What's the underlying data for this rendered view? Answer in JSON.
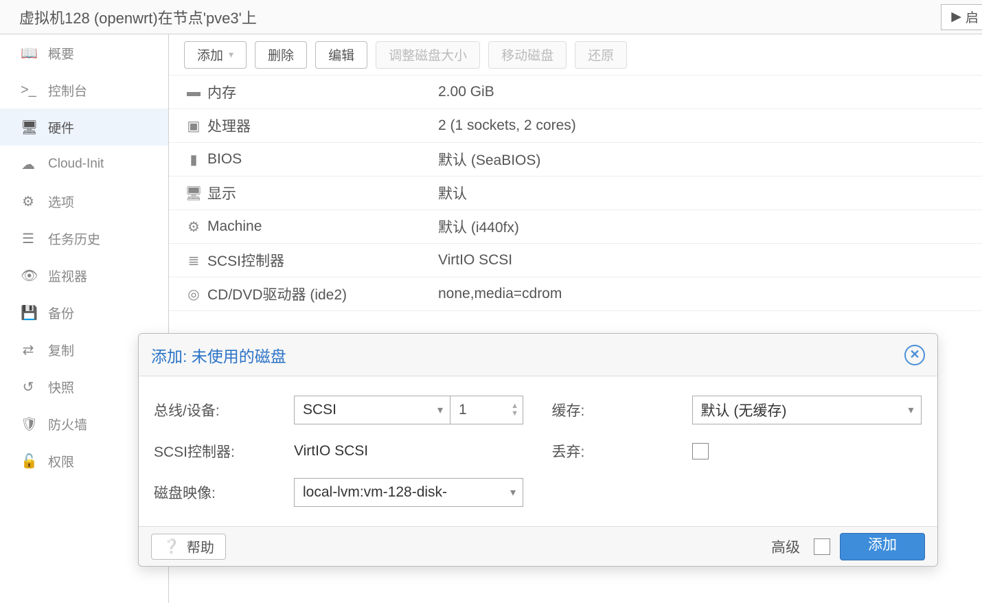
{
  "header": {
    "title": "虚拟机128 (openwrt)在节点'pve3'上",
    "start_label": "启"
  },
  "sidebar": {
    "items": [
      {
        "label": "概要"
      },
      {
        "label": "控制台"
      },
      {
        "label": "硬件"
      },
      {
        "label": "Cloud-Init"
      },
      {
        "label": "选项"
      },
      {
        "label": "任务历史"
      },
      {
        "label": "监视器"
      },
      {
        "label": "备份"
      },
      {
        "label": "复制"
      },
      {
        "label": "快照"
      },
      {
        "label": "防火墙"
      },
      {
        "label": "权限"
      }
    ]
  },
  "toolbar": {
    "add_label": "添加",
    "delete_label": "删除",
    "edit_label": "编辑",
    "resize_label": "调整磁盘大小",
    "move_label": "移动磁盘",
    "restore_label": "还原"
  },
  "hw": {
    "memory": {
      "name": "内存",
      "value": "2.00 GiB"
    },
    "cpu": {
      "name": "处理器",
      "value": "2 (1 sockets, 2 cores)"
    },
    "bios": {
      "name": "BIOS",
      "value": "默认 (SeaBIOS)"
    },
    "display": {
      "name": "显示",
      "value": "默认"
    },
    "machine": {
      "name": "Machine",
      "value": "默认 (i440fx)"
    },
    "scsi": {
      "name": "SCSI控制器",
      "value": "VirtIO SCSI"
    },
    "cdrom": {
      "name": "CD/DVD驱动器 (ide2)",
      "value": "none,media=cdrom"
    }
  },
  "dialog": {
    "title": "添加: 未使用的磁盘",
    "bus_label": "总线/设备:",
    "bus_value": "SCSI",
    "device_value": "1",
    "scsi_label": "SCSI控制器:",
    "scsi_value": "VirtIO SCSI",
    "image_label": "磁盘映像:",
    "image_value": "local-lvm:vm-128-disk-",
    "cache_label": "缓存:",
    "cache_value": "默认 (无缓存)",
    "discard_label": "丢弃:",
    "help_label": "帮助",
    "advanced_label": "高级",
    "add_label": "添加"
  }
}
